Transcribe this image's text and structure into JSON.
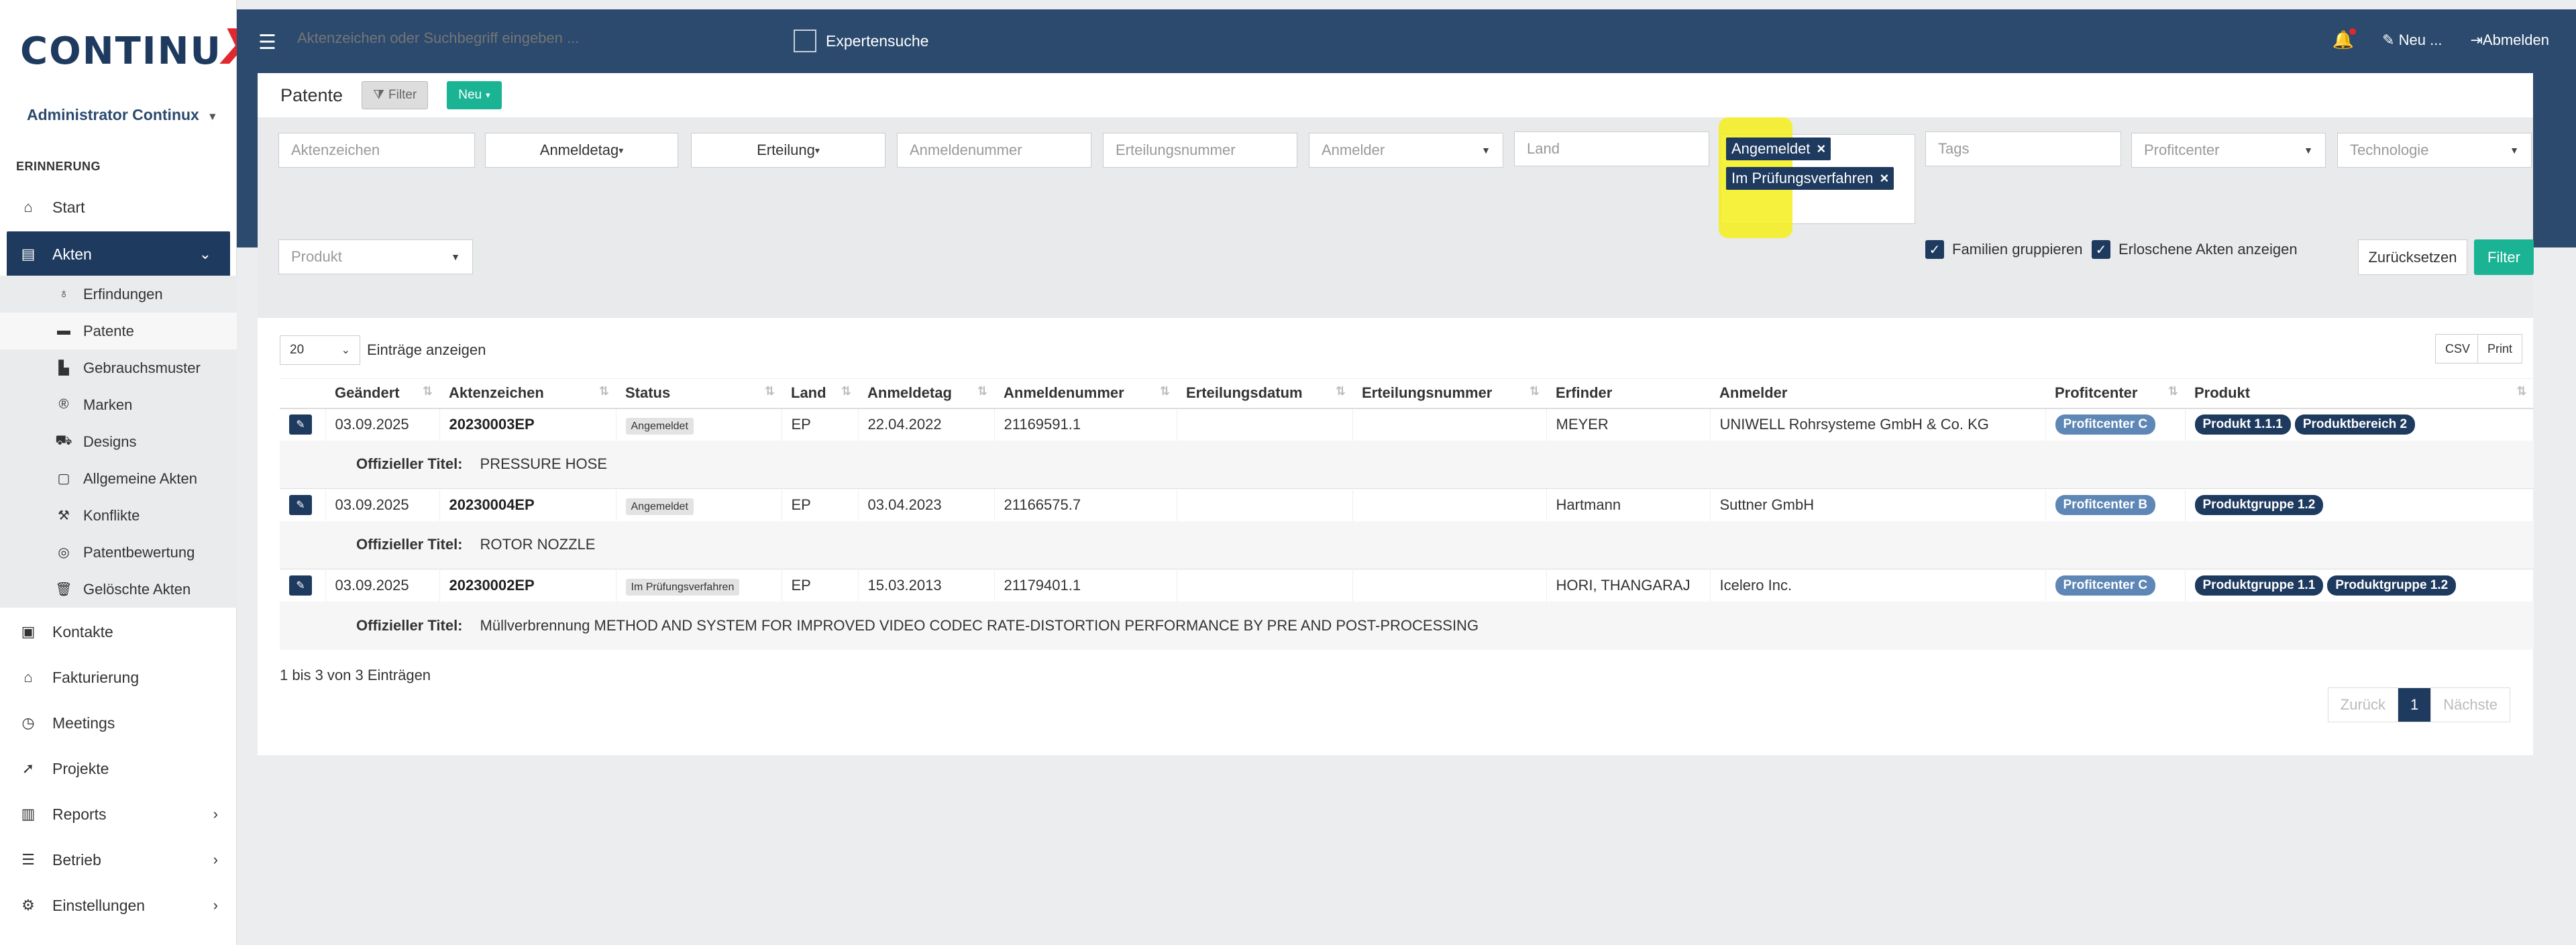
{
  "brand": {
    "logo_text": "CONTINU",
    "logo_x": "X"
  },
  "sidebar": {
    "user": "Administrator Continux",
    "section": "ERINNERUNG",
    "items": [
      {
        "label": "Start",
        "icon": "home-icon"
      },
      {
        "label": "Akten",
        "icon": "file-icon",
        "active": true
      },
      {
        "label": "Kontakte",
        "icon": "contact-icon"
      },
      {
        "label": "Fakturierung",
        "icon": "bank-icon"
      },
      {
        "label": "Meetings",
        "icon": "clock-icon"
      },
      {
        "label": "Projekte",
        "icon": "rocket-icon"
      },
      {
        "label": "Reports",
        "icon": "bar-chart-icon"
      },
      {
        "label": "Betrieb",
        "icon": "list-icon"
      },
      {
        "label": "Einstellungen",
        "icon": "cogs-icon"
      }
    ],
    "subitems": [
      {
        "label": "Erfindungen",
        "icon": "lightbulb-icon"
      },
      {
        "label": "Patente",
        "icon": "briefcase-icon",
        "current": true
      },
      {
        "label": "Gebrauchsmuster",
        "icon": "industry-icon"
      },
      {
        "label": "Marken",
        "icon": "registered-icon"
      },
      {
        "label": "Designs",
        "icon": "car-icon"
      },
      {
        "label": "Allgemeine Akten",
        "icon": "document-icon"
      },
      {
        "label": "Konflikte",
        "icon": "gavel-icon"
      },
      {
        "label": "Patentbewertung",
        "icon": "target-icon"
      },
      {
        "label": "Gelöschte Akten",
        "icon": "trash-icon"
      }
    ]
  },
  "topbar": {
    "search_placeholder": "Aktenzeichen oder Suchbegriff eingeben ...",
    "expert_label": "Expertensuche",
    "new_label": "Neu ...",
    "logout_label": "Abmelden"
  },
  "panel": {
    "title": "Patente",
    "filter_btn": "Filter",
    "new_btn": "Neu",
    "fields": {
      "aktenzeichen": "Aktenzeichen",
      "anmeldetag": "Anmeldetag",
      "erteilung": "Erteilung",
      "anmeldenummer": "Anmeldenummer",
      "erteilungsnummer": "Erteilungsnummer",
      "anmelder": "Anmelder",
      "land": "Land",
      "tags": "Tags",
      "profitcenter": "Profitcenter",
      "technologie": "Technologie",
      "produkt": "Produkt"
    },
    "status_tags": [
      "Angemeldet",
      "Im Prüfungsverfahren"
    ],
    "check_families": "Familien gruppieren",
    "check_expired": "Erloschene Akten anzeigen",
    "reset_btn": "Zurücksetzen",
    "apply_btn": "Filter"
  },
  "results": {
    "page_size": "20",
    "entries_label": "Einträge anzeigen",
    "csv": "CSV",
    "print": "Print",
    "columns": [
      "Geändert",
      "Aktenzeichen",
      "Status",
      "Land",
      "Anmeldetag",
      "Anmeldenummer",
      "Erteilungsdatum",
      "Erteilungsnummer",
      "Erfinder",
      "Anmelder",
      "Profitcenter",
      "Produkt"
    ],
    "detail_label": "Offizieller Titel:",
    "rows": [
      {
        "geaendert": "03.09.2025",
        "aktenzeichen": "20230003EP",
        "status": "Angemeldet",
        "land": "EP",
        "anmeldetag": "22.04.2022",
        "anmeldenummer": "21169591.1",
        "erfinder": "MEYER",
        "anmelder": "UNIWELL Rohrsysteme GmbH & Co. KG",
        "profitcenter": "Profitcenter C",
        "produkt": [
          "Produkt 1.1.1",
          "Produktbereich 2"
        ],
        "titel": "PRESSURE HOSE"
      },
      {
        "geaendert": "03.09.2025",
        "aktenzeichen": "20230004EP",
        "status": "Angemeldet",
        "land": "EP",
        "anmeldetag": "03.04.2023",
        "anmeldenummer": "21166575.7",
        "erfinder": "Hartmann",
        "anmelder": "Suttner GmbH",
        "profitcenter": "Profitcenter B",
        "produkt": [
          "Produktgruppe 1.2"
        ],
        "titel": "ROTOR NOZZLE"
      },
      {
        "geaendert": "03.09.2025",
        "aktenzeichen": "20230002EP",
        "status": "Im Prüfungsverfahren",
        "land": "EP",
        "anmeldetag": "15.03.2013",
        "anmeldenummer": "21179401.1",
        "erfinder": "HORI, THANGARAJ",
        "anmelder": "Icelero Inc.",
        "profitcenter": "Profitcenter C",
        "produkt": [
          "Produktgruppe 1.1",
          "Produktgruppe 1.2"
        ],
        "titel": "Müllverbrennung METHOD AND SYSTEM FOR IMPROVED VIDEO CODEC RATE-DISTORTION PERFORMANCE BY PRE AND POST-PROCESSING"
      }
    ],
    "summary": "1 bis 3 von 3 Einträgen",
    "pager": {
      "prev": "Zurück",
      "page": "1",
      "next": "Nächste"
    }
  }
}
